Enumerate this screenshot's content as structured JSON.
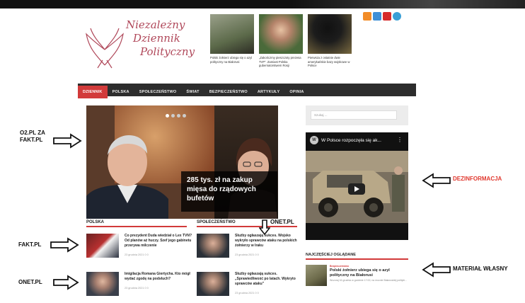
{
  "logo": {
    "line1": "Niezależny",
    "line2": "Dziennik",
    "line3": "Polityczny"
  },
  "top_posts": [
    {
      "caption": "Polski żołnierz ubiega się o azyl polityczny na Białorusi"
    },
    {
      "caption": "„Zakończmy pieszczoty prezesa TVP”. Zamiast Polska gubernatorstwem Rosji"
    },
    {
      "caption": "Pierwsza z ostatnie dwie amerykańskie bazy wojskowe w Polsce"
    }
  ],
  "social_icons": [
    {
      "name": "rss-icon",
      "color": "#f28c28"
    },
    {
      "name": "twitter-icon",
      "color": "#3f8fd6"
    },
    {
      "name": "youtube-icon",
      "color": "#d62b2b"
    },
    {
      "name": "telegram-icon",
      "color": "#3a9fd6"
    }
  ],
  "nav": {
    "items": [
      "DZIENNIK",
      "POLSKA",
      "SPOŁECZEŃSTWO",
      "ŚWIAT",
      "BEZPIECZEŃSTWO",
      "ARTYKUŁY",
      "OPINIA"
    ]
  },
  "hero": {
    "headline": "285 tys. zł na zakup mięsa do rządowych bufetów"
  },
  "sections": {
    "polska": {
      "title": "POLSKA",
      "posts": [
        {
          "title": "Co prezydent Duda wiedział o Lex TVN? Od planów aż huczy. Szef jego gabinetu przerywa milczenie",
          "meta": "23 grudnia 2021  0  0"
        },
        {
          "title": "Imigilacja Romana Giertycha. Kto mógł wydać zgodę na podsłuch?",
          "meta": "23 grudnia 2021  0  0"
        }
      ]
    },
    "spoleczenstwo": {
      "title": "SPOŁECZEŃSTWO",
      "posts": [
        {
          "title": "Służby ogłaszają sukces. Wojsko wykryło sprawców ataku na polskich żołnierzy w Iraku",
          "meta": "23 grudnia 2021  0  0"
        },
        {
          "title": "Służby ogłaszają sukces. „Sprawiedliwość po latach. Wykryto sprawców ataku”",
          "meta": "23 grudnia 2021  0  0"
        }
      ]
    }
  },
  "sidebar": {
    "search_placeholder": "Szukaj ...",
    "video_title": "W Polsce rozpoczęła się ak...",
    "video_channel_letter": "W",
    "most_watched_title": "NAJCZĘŚCIEJ OGLĄDANE",
    "most_watched_post": {
      "category": "Bezpieczeństwo",
      "title": "Polski żołnierz ubiega się o azyl polityczny na Białorusi",
      "desc": "Wczoraj 16 grudnia w godzinie 17:00, na mocnie Białoruskiej polityki…"
    }
  },
  "annotations": {
    "o2": "O2.PL ZA FAKT.PL",
    "dezinformacja": "DEZINFORMACJA",
    "onet_top": "ONET.PL",
    "fakt": "FAKT.PL",
    "material": "MATERIAŁ WŁASNY",
    "onet_bottom": "ONET.PL"
  },
  "colors": {
    "accent": "#d23a3a",
    "nav_bg": "#2d2d2d",
    "logo": "#b0485a",
    "annotation_red": "#e0382e"
  }
}
